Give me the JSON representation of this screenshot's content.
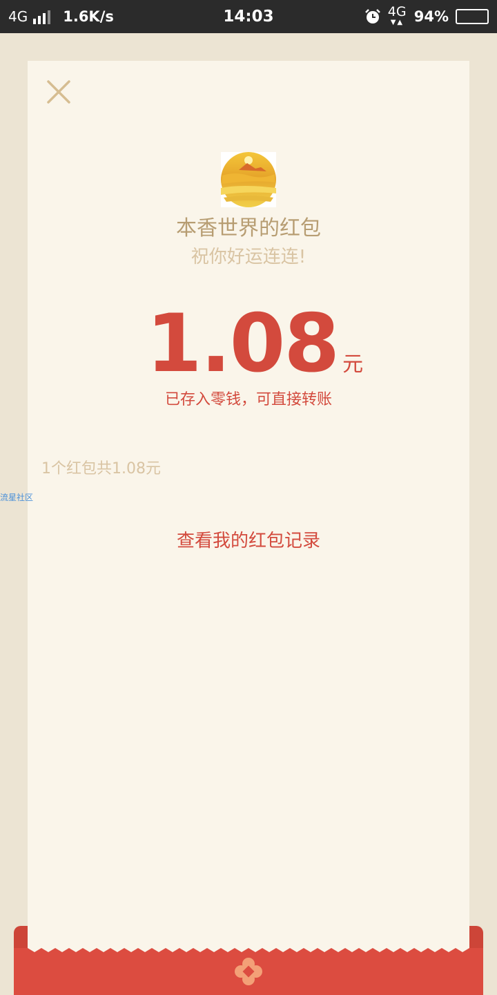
{
  "status_bar": {
    "network": "4G",
    "speed": "1.6K/s",
    "time": "14:03",
    "network_right": "4G",
    "battery": "94%",
    "icons": [
      "signal-icon",
      "alarm-icon",
      "battery-icon"
    ]
  },
  "card": {
    "sender": "本香世界的红包",
    "wish": "祝你好运连连!",
    "amount": "1.08",
    "unit": "元",
    "saved_note": "已存入零钱，可直接转账",
    "summary": "1个红包共1.08元",
    "history_link": "查看我的红包记录",
    "watermark": "流星社区"
  },
  "colors": {
    "background": "#ece4d3",
    "card": "#faf5ea",
    "accent_red": "#d34a3d",
    "gold_text": "#b79d72",
    "light_gold_text": "#d9c4a3",
    "envelope_red": "#dc4c40"
  }
}
